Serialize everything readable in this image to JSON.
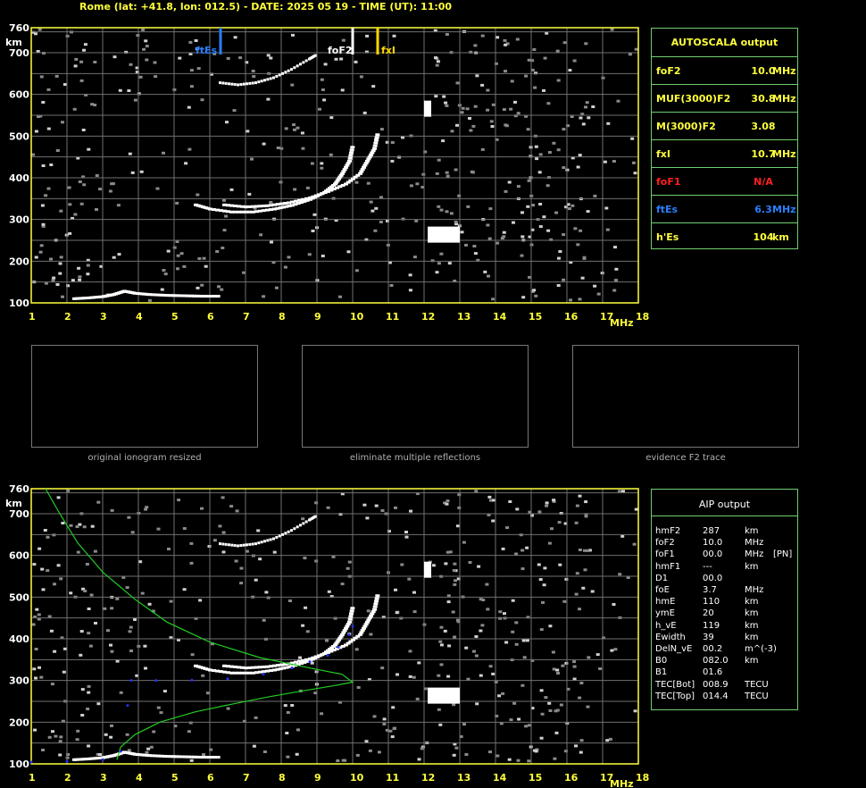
{
  "header": {
    "title": "Rome (lat: +41.8, lon: 012.5) - DATE: 2025 05 19 - TIME (UT): 11:00"
  },
  "colors": {
    "grid_border": "#ffff3c",
    "grid": "#707070",
    "panel_border": "#6fcf6f",
    "fte_marker": "#2a7fff",
    "fof2_marker": "#ffffff",
    "fxi_marker": "#ffd800",
    "profile": "#22cc22",
    "trace_fit": "#2233ff"
  },
  "chart_data": [
    {
      "type": "scatter",
      "title": "",
      "xlabel": "MHz",
      "ylabel": "km",
      "xlim": [
        1,
        18
      ],
      "ylim": [
        100,
        760
      ],
      "x_ticks": [
        "1",
        "2",
        "3",
        "4",
        "5",
        "6",
        "7",
        "8",
        "9",
        "10",
        "11",
        "12",
        "13",
        "14",
        "15",
        "16",
        "17",
        "18"
      ],
      "y_ticks": [
        "100",
        "200",
        "300",
        "400",
        "500",
        "600",
        "700",
        "760"
      ],
      "markers": [
        {
          "label": "ftEs",
          "x": 6.3,
          "color": "#2a7fff"
        },
        {
          "label": "foF2",
          "x": 10.0,
          "color": "#ffffff"
        },
        {
          "label": "fxI",
          "x": 10.7,
          "color": "#ffd800"
        }
      ],
      "traces": {
        "E_layer": [
          [
            2.2,
            110
          ],
          [
            2.6,
            112
          ],
          [
            3.0,
            115
          ],
          [
            3.3,
            120
          ],
          [
            3.6,
            128
          ],
          [
            3.9,
            123
          ],
          [
            4.3,
            120
          ],
          [
            4.8,
            118
          ],
          [
            5.3,
            117
          ],
          [
            5.8,
            116
          ],
          [
            6.3,
            116
          ]
        ],
        "F2_ordinary": [
          [
            5.6,
            335
          ],
          [
            6.0,
            325
          ],
          [
            6.6,
            318
          ],
          [
            7.2,
            318
          ],
          [
            7.8,
            325
          ],
          [
            8.3,
            334
          ],
          [
            8.8,
            348
          ],
          [
            9.2,
            365
          ],
          [
            9.5,
            385
          ],
          [
            9.7,
            410
          ],
          [
            9.9,
            440
          ],
          [
            10.0,
            480
          ]
        ],
        "F2_extraordinary": [
          [
            6.4,
            335
          ],
          [
            7.0,
            330
          ],
          [
            7.6,
            333
          ],
          [
            8.2,
            340
          ],
          [
            8.8,
            352
          ],
          [
            9.3,
            367
          ],
          [
            9.8,
            385
          ],
          [
            10.2,
            410
          ],
          [
            10.4,
            440
          ],
          [
            10.6,
            470
          ],
          [
            10.7,
            510
          ]
        ],
        "multiple_reflection": [
          [
            6.3,
            628
          ],
          [
            6.8,
            623
          ],
          [
            7.3,
            628
          ],
          [
            7.8,
            640
          ],
          [
            8.3,
            660
          ],
          [
            8.8,
            685
          ],
          [
            9.0,
            695
          ]
        ]
      }
    },
    {
      "type": "line",
      "title": "",
      "xlabel": "MHz",
      "ylabel": "km",
      "xlim": [
        1,
        18
      ],
      "ylim": [
        100,
        760
      ],
      "series": [
        {
          "values": [
            [
              3.4,
              110
            ],
            [
              3.5,
              140
            ],
            [
              3.9,
              170
            ],
            [
              4.6,
              200
            ],
            [
              5.6,
              225
            ],
            [
              6.6,
              243
            ],
            [
              7.6,
              260
            ],
            [
              8.6,
              275
            ],
            [
              9.5,
              288
            ],
            [
              10.0,
              296
            ],
            [
              9.7,
              315
            ],
            [
              8.8,
              330
            ],
            [
              7.4,
              355
            ],
            [
              6.0,
              392
            ],
            [
              4.8,
              440
            ],
            [
              3.9,
              495
            ],
            [
              3.0,
              560
            ],
            [
              2.3,
              630
            ],
            [
              1.8,
              700
            ],
            [
              1.4,
              760
            ]
          ]
        },
        {
          "values": [
            [
              1.0,
              104
            ],
            [
              2.0,
              106
            ],
            [
              3.0,
              110
            ],
            [
              3.5,
              130
            ],
            [
              3.7,
              240
            ],
            [
              3.8,
              300
            ],
            [
              4.5,
              300
            ],
            [
              5.5,
              301
            ],
            [
              6.5,
              304
            ],
            [
              7.5,
              315
            ],
            [
              8.3,
              330
            ],
            [
              8.8,
              345
            ],
            [
              9.3,
              360
            ],
            [
              9.6,
              380
            ],
            [
              9.9,
              410
            ],
            [
              10.0,
              430
            ]
          ]
        }
      ]
    }
  ],
  "ionogram_top": {
    "ylabel": "km",
    "xunit": "MHz"
  },
  "ionogram_bottom": {
    "ylabel": "km",
    "xunit": "MHz"
  },
  "autoscala": {
    "title": "AUTOSCALA output",
    "rows": [
      {
        "label": "foF2",
        "value": "10.0",
        "unit": "MHz",
        "color": "#ffff3c"
      },
      {
        "label": "MUF(3000)F2",
        "value": "30.8",
        "unit": "MHz",
        "color": "#ffff3c"
      },
      {
        "label": "M(3000)F2",
        "value": "3.08",
        "unit": "",
        "color": "#ffff3c"
      },
      {
        "label": "fxI",
        "value": "10.7",
        "unit": "MHz",
        "color": "#ffff3c"
      },
      {
        "label": "foF1",
        "value": "N/A",
        "unit": "",
        "color": "#ff2020"
      },
      {
        "label": "ftEs",
        "value": "6.3",
        "unit": "MHz",
        "color": "#2a7fff"
      },
      {
        "label": "h'Es",
        "value": "104",
        "unit": "km",
        "color": "#ffff3c"
      }
    ]
  },
  "aip": {
    "title": "AIP output",
    "rows": [
      {
        "name": "hmF2",
        "value": "287",
        "unit": "km",
        "extra": ""
      },
      {
        "name": "foF2",
        "value": "10.0",
        "unit": "MHz",
        "extra": ""
      },
      {
        "name": "foF1",
        "value": "00.0",
        "unit": "MHz",
        "extra": "[PN]"
      },
      {
        "name": "hmF1",
        "value": "---",
        "unit": "km",
        "extra": ""
      },
      {
        "name": "D1",
        "value": "00.0",
        "unit": "",
        "extra": ""
      },
      {
        "name": "foE",
        "value": "3.7",
        "unit": "MHz",
        "extra": ""
      },
      {
        "name": "hmE",
        "value": "110",
        "unit": "km",
        "extra": ""
      },
      {
        "name": "ymE",
        "value": "20",
        "unit": "km",
        "extra": ""
      },
      {
        "name": "h_vE",
        "value": "119",
        "unit": "km",
        "extra": ""
      },
      {
        "name": "Ewidth",
        "value": "39",
        "unit": "km",
        "extra": ""
      },
      {
        "name": "DelN_vE",
        "value": "00.2",
        "unit": "m^(-3)",
        "extra": ""
      },
      {
        "name": "B0",
        "value": "082.0",
        "unit": "km",
        "extra": ""
      },
      {
        "name": "B1",
        "value": "01.6",
        "unit": "",
        "extra": ""
      },
      {
        "name": "TEC[Bot]",
        "value": "008.9",
        "unit": "TECU",
        "extra": ""
      },
      {
        "name": "TEC[Top]",
        "value": "014.4",
        "unit": "TECU",
        "extra": ""
      }
    ]
  },
  "thumbnails": [
    {
      "caption": "original ionogram resized"
    },
    {
      "caption": "eliminate multiple reflections"
    },
    {
      "caption": "evidence F2 trace"
    }
  ]
}
